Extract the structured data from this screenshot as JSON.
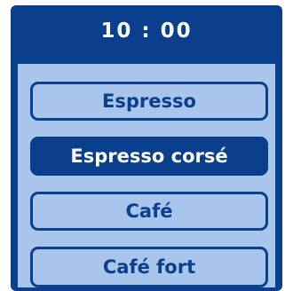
{
  "display": {
    "time": "10 : 00"
  },
  "menu": {
    "items": [
      {
        "label": "Espresso",
        "selected": false
      },
      {
        "label": "Espresso corsé",
        "selected": true
      },
      {
        "label": "Café",
        "selected": false
      },
      {
        "label": "Café fort",
        "selected": false
      }
    ]
  },
  "colors": {
    "frame": "#0a3f8e",
    "screen": "#a9c5ec",
    "selected_text": "#ffffff"
  }
}
